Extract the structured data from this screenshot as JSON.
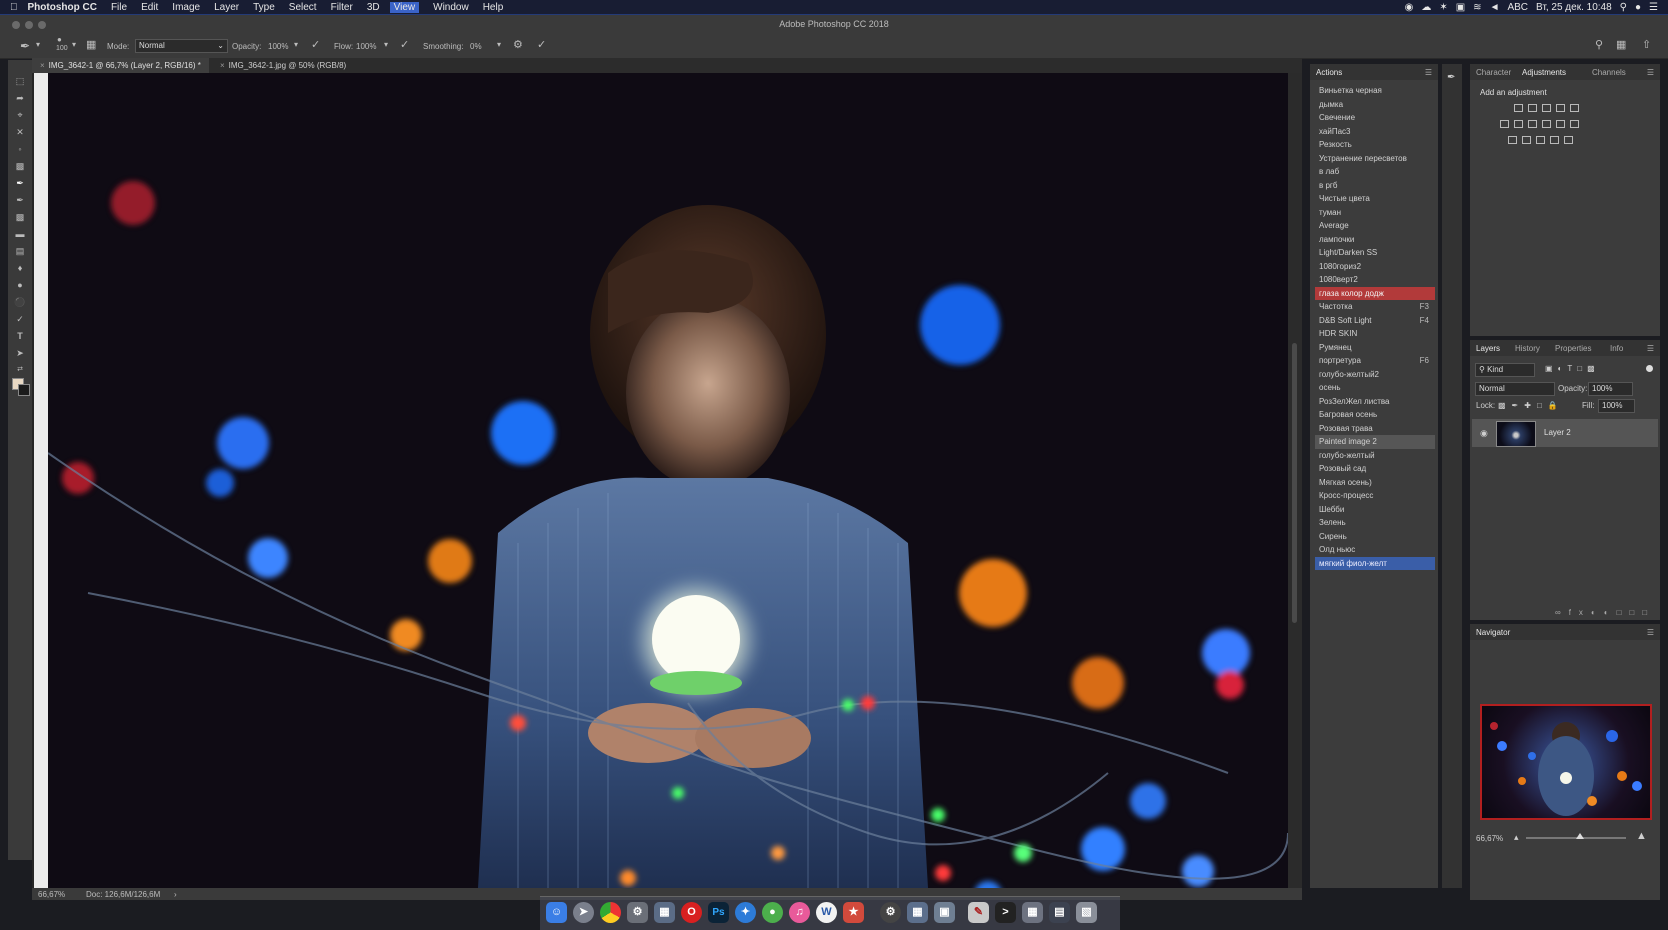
{
  "menubar": {
    "app_name": "Photoshop CC",
    "items": [
      "File",
      "Edit",
      "Image",
      "Layer",
      "Type",
      "Select",
      "Filter",
      "3D",
      "View",
      "Window",
      "Help"
    ],
    "active_item": "View",
    "input_source": "ABC",
    "clock": "Вт, 25 дек. 10:48"
  },
  "window": {
    "title": "Adobe Photoshop CC 2018"
  },
  "options_bar": {
    "brush_size": "100",
    "mode_label": "Mode:",
    "mode_value": "Normal",
    "opacity_label": "Opacity:",
    "opacity_value": "100%",
    "flow_label": "Flow:",
    "flow_value": "100%",
    "smoothing_label": "Smoothing:",
    "smoothing_value": "0%"
  },
  "doc_tabs": [
    {
      "label": "IMG_3642-1 @ 66,7% (Layer 2, RGB/16) *",
      "active": true
    },
    {
      "label": "IMG_3642-1.jpg @ 50% (RGB/8)",
      "active": false
    }
  ],
  "status_bar": {
    "zoom": "66,67%",
    "doc": "Doc: 126,6M/126,6M",
    "arrow": "›"
  },
  "actions_panel": {
    "tab": "Actions",
    "items": [
      {
        "label": "Виньетка черная",
        "key": ""
      },
      {
        "label": "дымка",
        "key": ""
      },
      {
        "label": "Свечение",
        "key": ""
      },
      {
        "label": "хайПас3",
        "key": ""
      },
      {
        "label": "Резкость",
        "key": ""
      },
      {
        "label": "Устранение пересветов",
        "key": ""
      },
      {
        "label": "в лаб",
        "key": ""
      },
      {
        "label": "в ргб",
        "key": ""
      },
      {
        "label": "Чистые цвета",
        "key": ""
      },
      {
        "label": "туман",
        "key": ""
      },
      {
        "label": "Average",
        "key": ""
      },
      {
        "label": "лампочки",
        "key": ""
      },
      {
        "label": "Light/Darken SS",
        "key": ""
      },
      {
        "label": "1080гориз2",
        "key": ""
      },
      {
        "label": "1080верт2",
        "key": ""
      },
      {
        "label": "глаза колор додж",
        "key": "",
        "state": "red"
      },
      {
        "label": "Частотка",
        "key": "F3"
      },
      {
        "label": "D&B Soft Light",
        "key": "F4"
      },
      {
        "label": "HDR SKIN",
        "key": ""
      },
      {
        "label": "Румянец",
        "key": ""
      },
      {
        "label": "портретура",
        "key": "F6"
      },
      {
        "label": "голубо-желтый2",
        "key": ""
      },
      {
        "label": "осень",
        "key": ""
      },
      {
        "label": "РозЗелЖел листва",
        "key": ""
      },
      {
        "label": "Багровая осень",
        "key": ""
      },
      {
        "label": "Розовая трава",
        "key": ""
      },
      {
        "label": "Painted image 2",
        "key": "",
        "state": "gray"
      },
      {
        "label": "голубо-желтый",
        "key": ""
      },
      {
        "label": "Розовый сад",
        "key": ""
      },
      {
        "label": "Мягкая осень)",
        "key": ""
      },
      {
        "label": "Кросс-процесс",
        "key": ""
      },
      {
        "label": "Шебби",
        "key": ""
      },
      {
        "label": "Зелень",
        "key": ""
      },
      {
        "label": "Сирень",
        "key": ""
      },
      {
        "label": "Олд ньюс",
        "key": ""
      },
      {
        "label": "мягкий фиол-желт",
        "key": "",
        "state": "blue"
      }
    ]
  },
  "adjustments_panel": {
    "tabs": [
      "Character",
      "Adjustments",
      "Channels"
    ],
    "active_tab": "Adjustments",
    "heading": "Add an adjustment"
  },
  "layers_panel": {
    "tabs": [
      "Layers",
      "History",
      "Properties",
      "Info"
    ],
    "active_tab": "Layers",
    "filter_kind": "Kind",
    "blend_mode": "Normal",
    "opacity_label": "Opacity:",
    "opacity_value": "100%",
    "lock_label": "Lock:",
    "fill_label": "Fill:",
    "fill_value": "100%",
    "layers": [
      {
        "name": "Layer 2",
        "visible": true
      }
    ]
  },
  "navigator_panel": {
    "tab": "Navigator",
    "zoom": "66,67%"
  },
  "colors": {
    "accent_red": "#b23a3a",
    "accent_blue": "#3a5ea8",
    "nav_frame": "#b21f1f"
  },
  "dock": {
    "icons": [
      "finder-icon",
      "launchpad-icon",
      "chrome-icon",
      "system-prefs-icon",
      "preview-icon",
      "opera-icon",
      "photoshop-icon",
      "safari-icon",
      "messages-icon",
      "itunes-icon",
      "word-icon",
      "reeder-icon",
      "settings-icon",
      "files-icon",
      "screenshot-icon",
      "script-icon",
      "terminal-icon",
      "downloads-icon",
      "activity-icon",
      "trash-icon"
    ],
    "photoshop_label": "Ps",
    "word_label": "W"
  }
}
